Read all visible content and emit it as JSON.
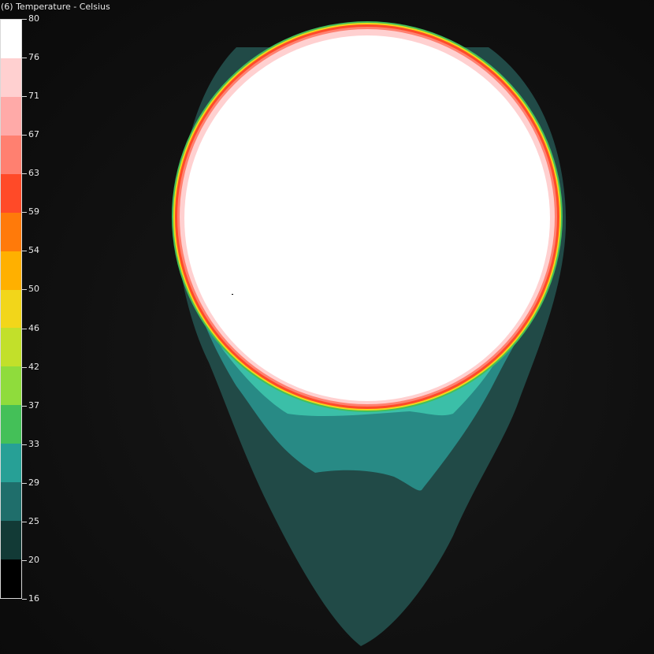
{
  "legend": {
    "title": "(6) Temperature - Celsius",
    "labels": [
      "80",
      "76",
      "71",
      "67",
      "63",
      "59",
      "54",
      "50",
      "46",
      "42",
      "37",
      "33",
      "29",
      "25",
      "20",
      "16"
    ],
    "colors_bottom_to_top": [
      "#000000",
      "#123a36",
      "#1f6e6b",
      "#27a096",
      "#44c058",
      "#8fdc3c",
      "#c2e02a",
      "#f2d61a",
      "#ffb000",
      "#ff7a0a",
      "#ff4a28",
      "#ff8070",
      "#ffaaa8",
      "#ffd0d0",
      "#ffffff"
    ],
    "min": 16,
    "max": 80
  },
  "plume": {
    "core_color": "#ffffff",
    "outer_color": "#1f4a47",
    "mid_color": "#288a85",
    "inner_color": "#3bbfa8",
    "rim_colors": [
      "#ffd0d0",
      "#ff4a28",
      "#f2d61a",
      "#44c058"
    ]
  }
}
